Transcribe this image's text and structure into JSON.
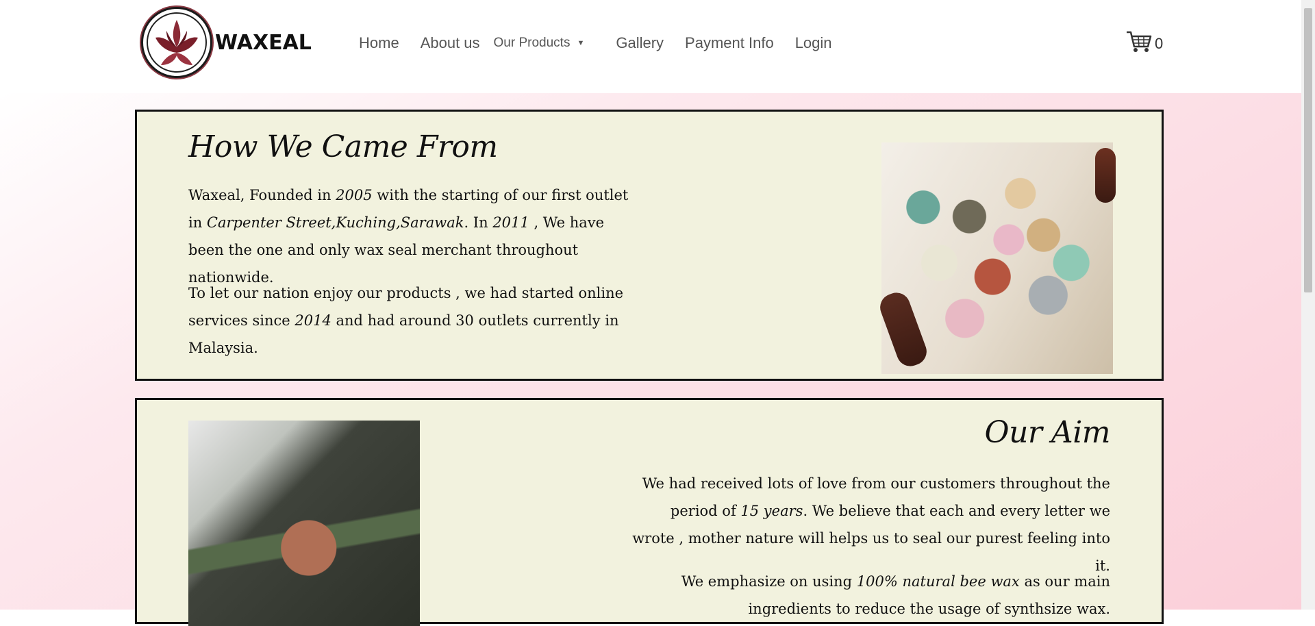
{
  "brand": {
    "name": "WAXEAL"
  },
  "nav": {
    "home": "Home",
    "about": "About us",
    "products": "Our Products",
    "gallery": "Gallery",
    "payment": "Payment Info",
    "login": "Login"
  },
  "cart": {
    "count": "0"
  },
  "sections": {
    "history": {
      "title": "How We Came From",
      "p1": [
        "Waxeal, Founded in ",
        "2005",
        " with the starting of our first outlet in ",
        "Carpenter Street,Kuching,Sarawak",
        ". In ",
        "2011",
        " , We have been the one and only wax seal merchant throughout nationwide."
      ],
      "p2": [
        "To let our nation enjoy our products , we had started online services since ",
        "2014",
        " and had around 30 outlets currently in Malaysia."
      ]
    },
    "aim": {
      "title": "Our Aim",
      "p1": [
        "We had received lots of love from our customers throughout the period of ",
        "15 years",
        ". We believe that each and every letter we wrote , mother nature will helps us to seal our purest feeling into it."
      ],
      "p2": [
        "We emphasize on using ",
        "100% natural bee wax",
        " as our main ingredients to reduce the usage of synthsize wax."
      ]
    }
  }
}
